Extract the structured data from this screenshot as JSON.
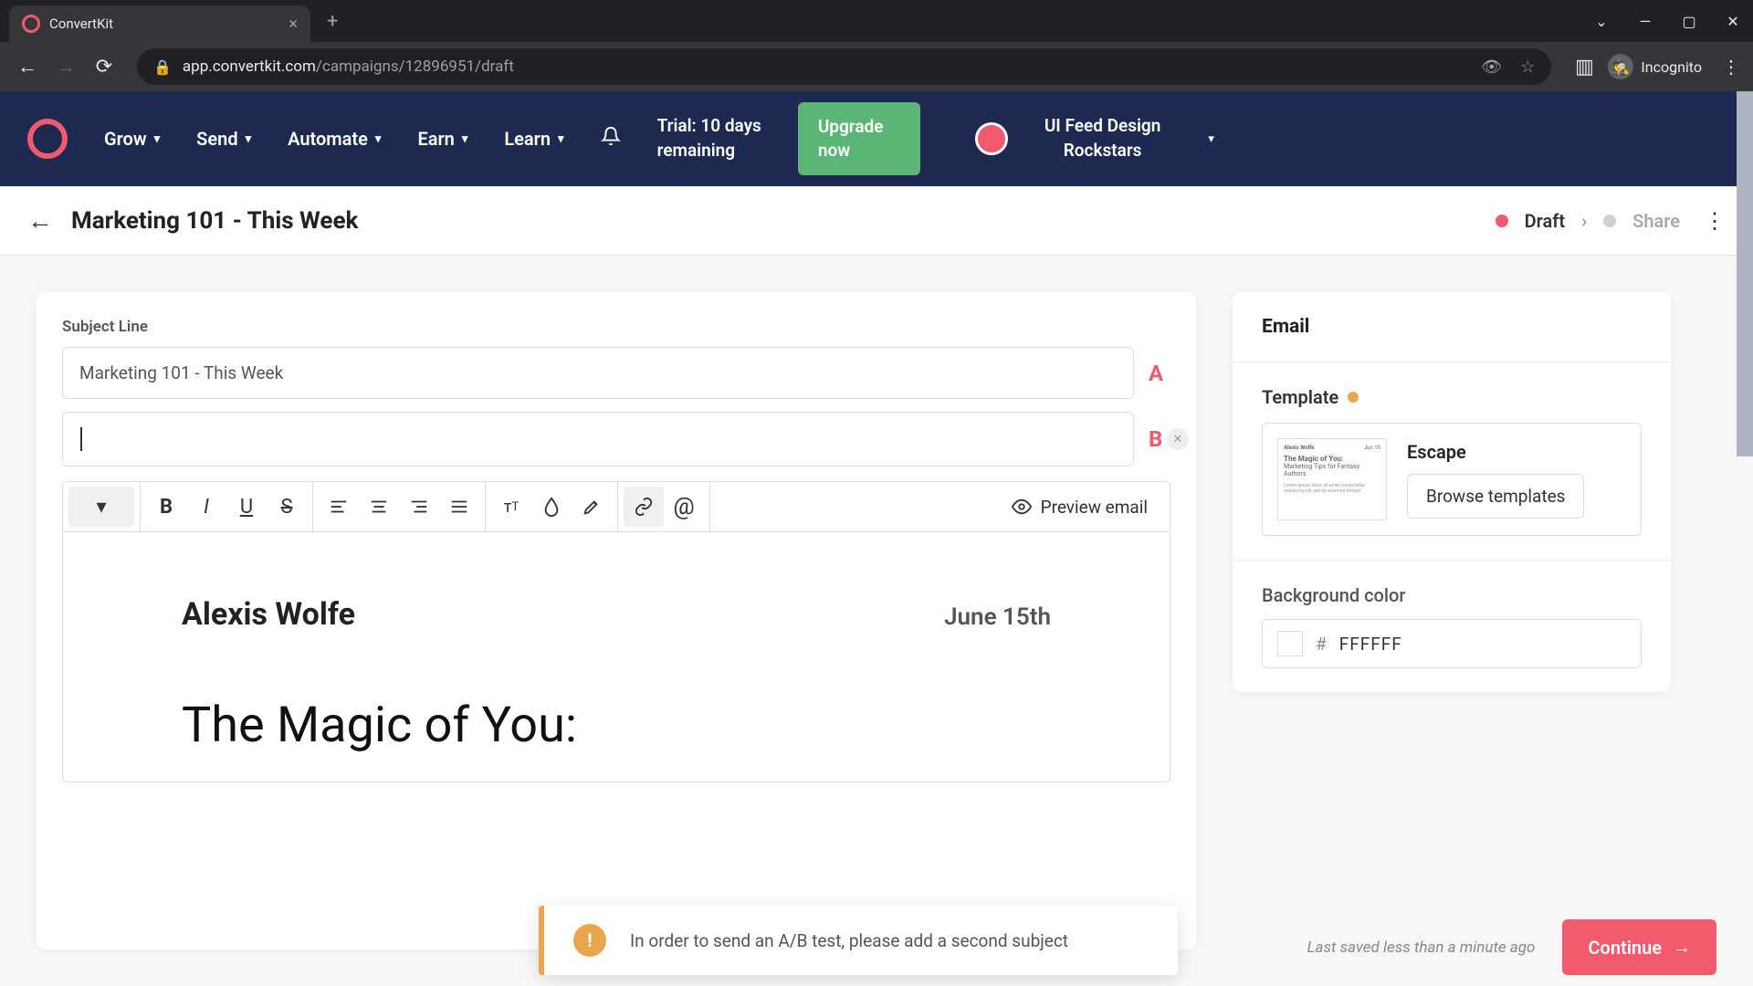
{
  "browser": {
    "tab_title": "ConvertKit",
    "url_domain": "app.convertkit.com",
    "url_path": "/campaigns/12896951/draft",
    "incognito_label": "Incognito"
  },
  "header": {
    "nav": [
      "Grow",
      "Send",
      "Automate",
      "Earn",
      "Learn"
    ],
    "trial_line1": "Trial: 10 days",
    "trial_line2": "remaining",
    "upgrade_label": "Upgrade now",
    "account_line1": "UI Feed Design",
    "account_line2": "Rockstars"
  },
  "page": {
    "title": "Marketing 101 - This Week",
    "status_draft": "Draft",
    "status_share": "Share"
  },
  "editor": {
    "subject_label": "Subject Line",
    "subject_a_value": "Marketing 101 - This Week",
    "subject_b_value": "",
    "ab_a": "A",
    "ab_b": "B",
    "preview_label": "Preview email",
    "email_sender": "Alexis Wolfe",
    "email_date": "June 15th",
    "email_headline": "The Magic of You:"
  },
  "sidebar": {
    "title": "Email",
    "template_label": "Template",
    "template_name": "Escape",
    "browse_label": "Browse templates",
    "bg_label": "Background color",
    "bg_value": "FFFFFF"
  },
  "toast": {
    "message": "In order to send an A/B test, please add a second subject"
  },
  "footer": {
    "saved_text": "Last saved less than a minute ago",
    "continue_label": "Continue"
  },
  "colors": {
    "brand_pink": "#f15a6c",
    "brand_green": "#5ab576",
    "warn_orange": "#e8a74e",
    "nav_bg": "#1e2952"
  }
}
